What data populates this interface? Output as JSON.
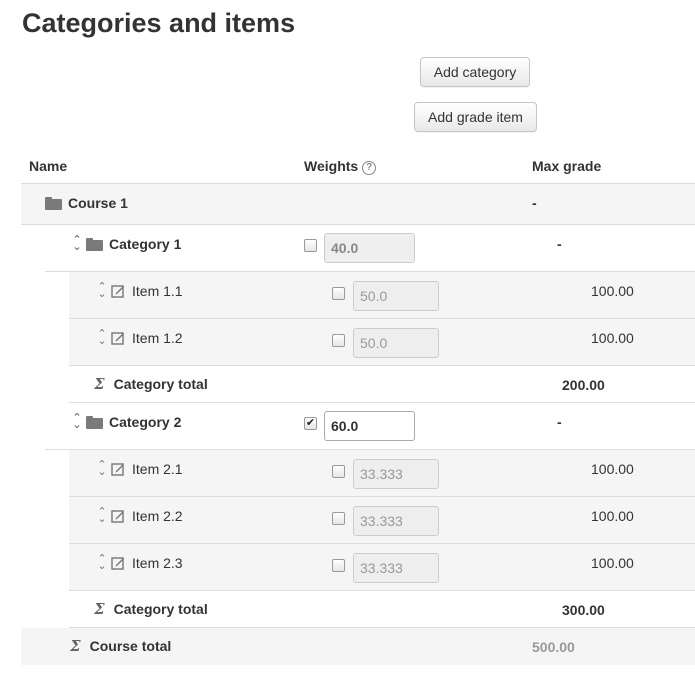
{
  "page_title": "Categories and items",
  "buttons": {
    "add_category": "Add category",
    "add_grade_item": "Add grade item"
  },
  "columns": {
    "name": "Name",
    "weights": "Weights",
    "max_grade": "Max grade",
    "help_glyph": "?"
  },
  "rows": [
    {
      "type": "course",
      "name": "Course 1",
      "max_grade": "-"
    },
    {
      "type": "category",
      "name": "Category 1",
      "checked": false,
      "weight": "40.0",
      "max_grade": "-"
    },
    {
      "type": "item",
      "name": "Item 1.1",
      "checked": false,
      "weight": "50.0",
      "max_grade": "100.00"
    },
    {
      "type": "item",
      "name": "Item 1.2",
      "checked": false,
      "weight": "50.0",
      "max_grade": "100.00"
    },
    {
      "type": "category_total",
      "name": "Category total",
      "max_grade": "200.00"
    },
    {
      "type": "category",
      "name": "Category 2",
      "checked": true,
      "weight": "60.0",
      "max_grade": "-"
    },
    {
      "type": "item",
      "name": "Item 2.1",
      "checked": false,
      "weight": "33.333",
      "max_grade": "100.00"
    },
    {
      "type": "item",
      "name": "Item 2.2",
      "checked": false,
      "weight": "33.333",
      "max_grade": "100.00"
    },
    {
      "type": "item",
      "name": "Item 2.3",
      "checked": false,
      "weight": "33.333",
      "max_grade": "100.00"
    },
    {
      "type": "category_total",
      "name": "Category total",
      "max_grade": "300.00"
    },
    {
      "type": "course_total",
      "name": "Course total",
      "max_grade": "500.00"
    }
  ],
  "check_glyph": "✔",
  "colors": {
    "row_grey": "#f5f5f5",
    "border": "#dddddd",
    "disabled_text": "#999999"
  }
}
